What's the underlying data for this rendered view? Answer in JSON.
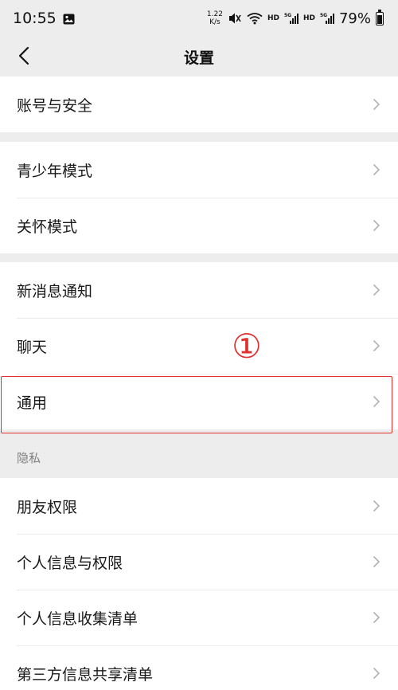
{
  "status_bar": {
    "time": "10:55",
    "net_speed_value": "1.22",
    "net_speed_unit": "K/s",
    "hd1": "HD",
    "hd2": "HD",
    "battery": "79%"
  },
  "nav": {
    "title": "设置"
  },
  "groups": {
    "account": [
      "账号与安全"
    ],
    "modes": [
      "青少年模式",
      "关怀模式"
    ],
    "messages": [
      "新消息通知",
      "聊天",
      "通用"
    ],
    "privacy_header": "隐私",
    "privacy": [
      "朋友权限",
      "个人信息与权限",
      "个人信息收集清单",
      "第三方信息共享清单"
    ]
  },
  "annotation": {
    "step_marker": "①",
    "color": "#e0312e"
  },
  "colors": {
    "background": "#ededed",
    "card": "#ffffff",
    "chevron": "#b2b2b2"
  }
}
